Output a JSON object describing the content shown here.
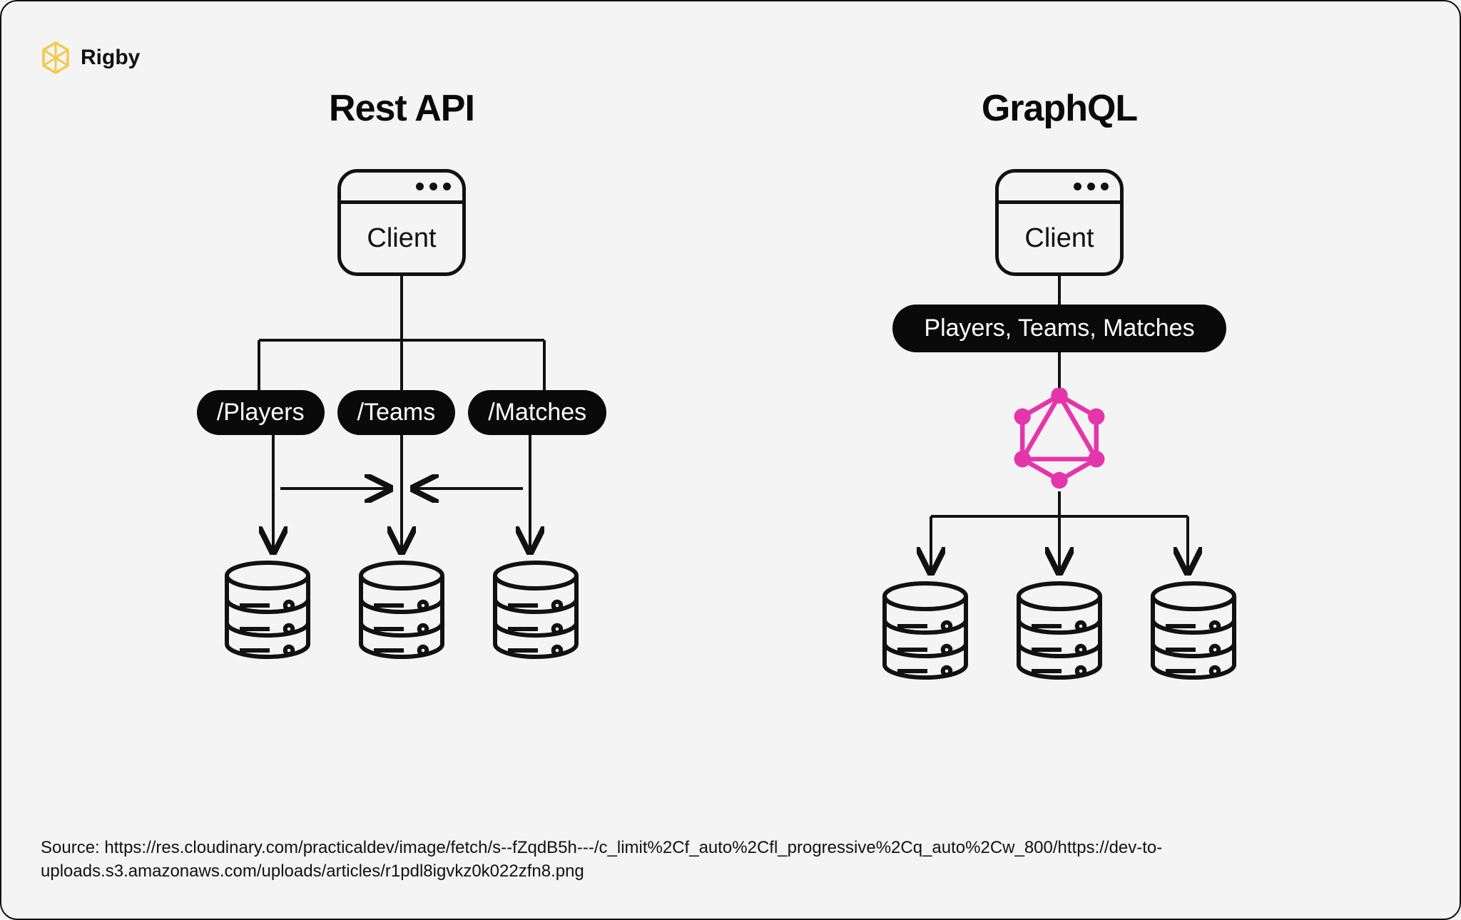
{
  "brand": {
    "name": "Rigby"
  },
  "left": {
    "title": "Rest API",
    "client_label": "Client",
    "endpoints": [
      "/Players",
      "/Teams",
      "/Matches"
    ]
  },
  "right": {
    "title": "GraphQL",
    "client_label": "Client",
    "query_label": "Players, Teams, Matches"
  },
  "source_text": "Source: https://res.cloudinary.com/practicaldev/image/fetch/s--fZqdB5h---/c_limit%2Cf_auto%2Cfl_progressive%2Cq_auto%2Cw_800/https://dev-to-uploads.s3.amazonaws.com/uploads/articles/r1pdl8igvkz0k022zfn8.png",
  "colors": {
    "accent": "#e535ab",
    "logo": "#f2c94c"
  }
}
